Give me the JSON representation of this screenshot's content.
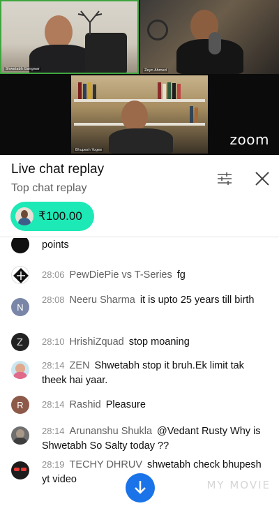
{
  "video": {
    "tile1_name": "Shwetabh Gangwar",
    "tile2_name": "Zeyn Ahmed",
    "tile3_name": "Bhupesh Yogee",
    "brand": "zoom"
  },
  "chat": {
    "title": "Live chat replay",
    "mode": "Top chat replay",
    "filter_icon": "sliders-icon",
    "close_icon": "close-icon",
    "superchat": {
      "amount": "₹100.00",
      "color": "#1de9b6"
    },
    "messages": [
      {
        "time": "",
        "author": "",
        "text": "points"
      },
      {
        "time": "28:06",
        "author": "PewDiePie vs T-Series",
        "text": "fg"
      },
      {
        "time": "28:08",
        "author": "Neeru Sharma",
        "text": "it is upto 25 years till birth",
        "avatar_letter": "N"
      },
      {
        "time": "28:10",
        "author": "HrishiZquad",
        "text": "stop moaning"
      },
      {
        "time": "28:14",
        "author": "ZEN",
        "text": "Shwetabh stop it bruh.Ek limit tak theek hai yaar."
      },
      {
        "time": "28:14",
        "author": "Rashid",
        "text": "Pleasure",
        "avatar_letter": "R"
      },
      {
        "time": "28:14",
        "author": "Arunanshu Shukla",
        "text": "@Vedant Rusty Why is Shwetabh So Salty today ??"
      },
      {
        "time": "28:19",
        "author": "TECHY DHRUV",
        "text": "shwetabh check bhupesh yt video"
      }
    ]
  },
  "watermark": "MY MOVIE"
}
